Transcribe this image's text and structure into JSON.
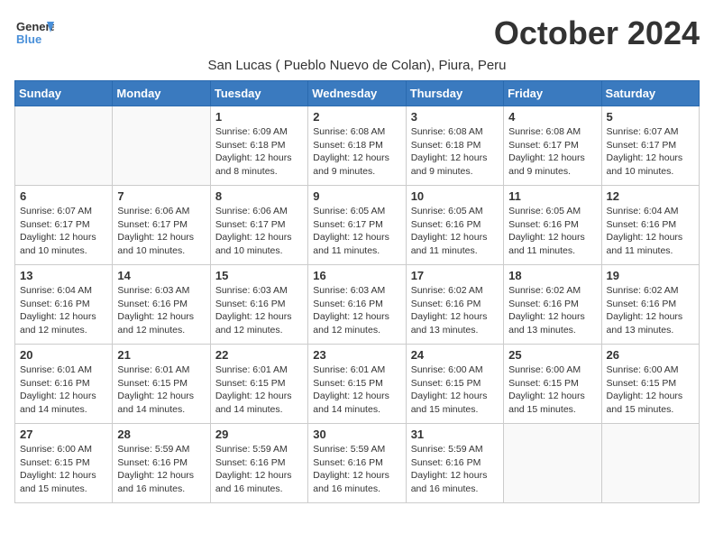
{
  "logo": {
    "general": "General",
    "blue": "Blue"
  },
  "title": "October 2024",
  "subtitle": "San Lucas ( Pueblo Nuevo de Colan), Piura, Peru",
  "days": [
    "Sunday",
    "Monday",
    "Tuesday",
    "Wednesday",
    "Thursday",
    "Friday",
    "Saturday"
  ],
  "weeks": [
    [
      {
        "day": "",
        "content": ""
      },
      {
        "day": "",
        "content": ""
      },
      {
        "day": "1",
        "content": "Sunrise: 6:09 AM\nSunset: 6:18 PM\nDaylight: 12 hours and 8 minutes."
      },
      {
        "day": "2",
        "content": "Sunrise: 6:08 AM\nSunset: 6:18 PM\nDaylight: 12 hours and 9 minutes."
      },
      {
        "day": "3",
        "content": "Sunrise: 6:08 AM\nSunset: 6:18 PM\nDaylight: 12 hours and 9 minutes."
      },
      {
        "day": "4",
        "content": "Sunrise: 6:08 AM\nSunset: 6:17 PM\nDaylight: 12 hours and 9 minutes."
      },
      {
        "day": "5",
        "content": "Sunrise: 6:07 AM\nSunset: 6:17 PM\nDaylight: 12 hours and 10 minutes."
      }
    ],
    [
      {
        "day": "6",
        "content": "Sunrise: 6:07 AM\nSunset: 6:17 PM\nDaylight: 12 hours and 10 minutes."
      },
      {
        "day": "7",
        "content": "Sunrise: 6:06 AM\nSunset: 6:17 PM\nDaylight: 12 hours and 10 minutes."
      },
      {
        "day": "8",
        "content": "Sunrise: 6:06 AM\nSunset: 6:17 PM\nDaylight: 12 hours and 10 minutes."
      },
      {
        "day": "9",
        "content": "Sunrise: 6:05 AM\nSunset: 6:17 PM\nDaylight: 12 hours and 11 minutes."
      },
      {
        "day": "10",
        "content": "Sunrise: 6:05 AM\nSunset: 6:16 PM\nDaylight: 12 hours and 11 minutes."
      },
      {
        "day": "11",
        "content": "Sunrise: 6:05 AM\nSunset: 6:16 PM\nDaylight: 12 hours and 11 minutes."
      },
      {
        "day": "12",
        "content": "Sunrise: 6:04 AM\nSunset: 6:16 PM\nDaylight: 12 hours and 11 minutes."
      }
    ],
    [
      {
        "day": "13",
        "content": "Sunrise: 6:04 AM\nSunset: 6:16 PM\nDaylight: 12 hours and 12 minutes."
      },
      {
        "day": "14",
        "content": "Sunrise: 6:03 AM\nSunset: 6:16 PM\nDaylight: 12 hours and 12 minutes."
      },
      {
        "day": "15",
        "content": "Sunrise: 6:03 AM\nSunset: 6:16 PM\nDaylight: 12 hours and 12 minutes."
      },
      {
        "day": "16",
        "content": "Sunrise: 6:03 AM\nSunset: 6:16 PM\nDaylight: 12 hours and 12 minutes."
      },
      {
        "day": "17",
        "content": "Sunrise: 6:02 AM\nSunset: 6:16 PM\nDaylight: 12 hours and 13 minutes."
      },
      {
        "day": "18",
        "content": "Sunrise: 6:02 AM\nSunset: 6:16 PM\nDaylight: 12 hours and 13 minutes."
      },
      {
        "day": "19",
        "content": "Sunrise: 6:02 AM\nSunset: 6:16 PM\nDaylight: 12 hours and 13 minutes."
      }
    ],
    [
      {
        "day": "20",
        "content": "Sunrise: 6:01 AM\nSunset: 6:16 PM\nDaylight: 12 hours and 14 minutes."
      },
      {
        "day": "21",
        "content": "Sunrise: 6:01 AM\nSunset: 6:15 PM\nDaylight: 12 hours and 14 minutes."
      },
      {
        "day": "22",
        "content": "Sunrise: 6:01 AM\nSunset: 6:15 PM\nDaylight: 12 hours and 14 minutes."
      },
      {
        "day": "23",
        "content": "Sunrise: 6:01 AM\nSunset: 6:15 PM\nDaylight: 12 hours and 14 minutes."
      },
      {
        "day": "24",
        "content": "Sunrise: 6:00 AM\nSunset: 6:15 PM\nDaylight: 12 hours and 15 minutes."
      },
      {
        "day": "25",
        "content": "Sunrise: 6:00 AM\nSunset: 6:15 PM\nDaylight: 12 hours and 15 minutes."
      },
      {
        "day": "26",
        "content": "Sunrise: 6:00 AM\nSunset: 6:15 PM\nDaylight: 12 hours and 15 minutes."
      }
    ],
    [
      {
        "day": "27",
        "content": "Sunrise: 6:00 AM\nSunset: 6:15 PM\nDaylight: 12 hours and 15 minutes."
      },
      {
        "day": "28",
        "content": "Sunrise: 5:59 AM\nSunset: 6:16 PM\nDaylight: 12 hours and 16 minutes."
      },
      {
        "day": "29",
        "content": "Sunrise: 5:59 AM\nSunset: 6:16 PM\nDaylight: 12 hours and 16 minutes."
      },
      {
        "day": "30",
        "content": "Sunrise: 5:59 AM\nSunset: 6:16 PM\nDaylight: 12 hours and 16 minutes."
      },
      {
        "day": "31",
        "content": "Sunrise: 5:59 AM\nSunset: 6:16 PM\nDaylight: 12 hours and 16 minutes."
      },
      {
        "day": "",
        "content": ""
      },
      {
        "day": "",
        "content": ""
      }
    ]
  ]
}
